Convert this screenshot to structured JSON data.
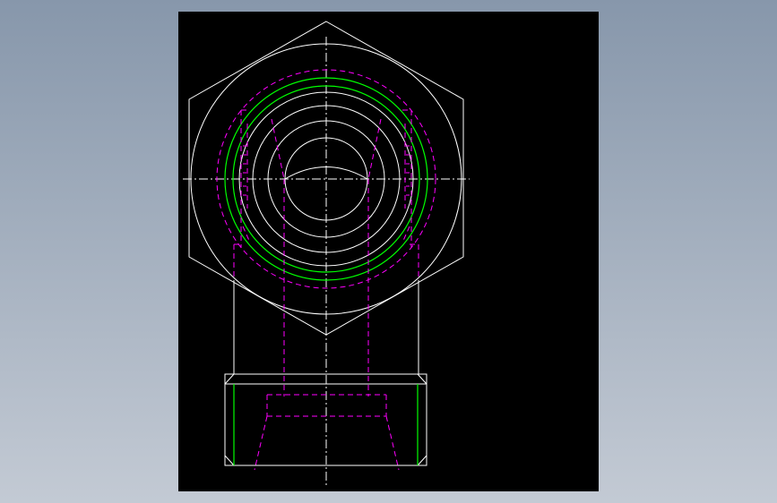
{
  "viewport": {
    "background": "#000000"
  },
  "colors": {
    "background_top": "#8797ab",
    "background_bottom": "#c3cad4",
    "outline": "#ffffff",
    "hidden_line": "#ff00ff",
    "thread": "#00ff00"
  },
  "drawing": {
    "views": [
      "hex-fitting-top-view",
      "thread-body-side-view"
    ],
    "line_types": [
      "visible-outline",
      "hidden-dashed",
      "center-dash-dot",
      "thread-green"
    ]
  }
}
